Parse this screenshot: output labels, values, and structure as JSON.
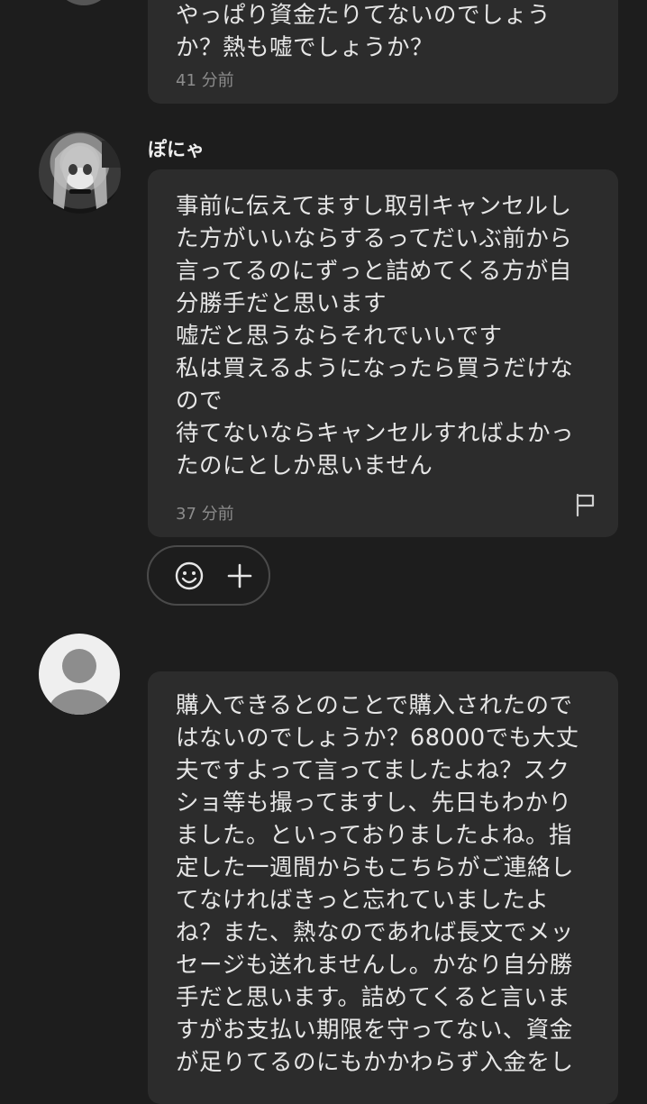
{
  "messages": [
    {
      "author": "",
      "lines": [
        "やっぱり資金たりてないのでしょう",
        "か？熱も嘘でしょうか？"
      ],
      "time": "41 分前"
    },
    {
      "author": "ぽにゃ",
      "lines": [
        "事前に伝えてますし取引キャンセルし",
        "た方がいいならするってだいぶ前から",
        "言ってるのにずっと詰めてくる方が自",
        "分勝手だと思います",
        "嘘だと思うならそれでいいです",
        "私は買えるようになったら買うだけな",
        "ので",
        "待てないならキャンセルすればよかっ",
        "たのにとしか思いません"
      ],
      "time": "37 分前"
    },
    {
      "author": "",
      "lines": [
        "購入できるとのことで購入されたので",
        "はないのでしょうか？68000でも大丈",
        "夫ですよって言ってましたよね？スク",
        "ショ等も撮ってますし、先日もわかり",
        "ました。といっておりましたよね。指",
        "定した一週間からもこちらがご連絡し",
        "てなければきっと忘れていましたよ",
        "ね？また、熱なのであれば長文でメッ",
        "セージも送れませんし。かなり自分勝",
        "手だと思います。詰めてくると言いま",
        "すがお支払い期限を守ってない、資金",
        "が足りてるのにもかかわらず入金をし"
      ]
    }
  ],
  "icons": {
    "flag": "flag-icon",
    "emoji": "smiley-icon",
    "add": "plus-icon"
  },
  "colors": {
    "background": "#1d1d1d",
    "bubble": "#2c2c2c",
    "text": "#e6e6e6",
    "muted": "#8c8c8c"
  }
}
